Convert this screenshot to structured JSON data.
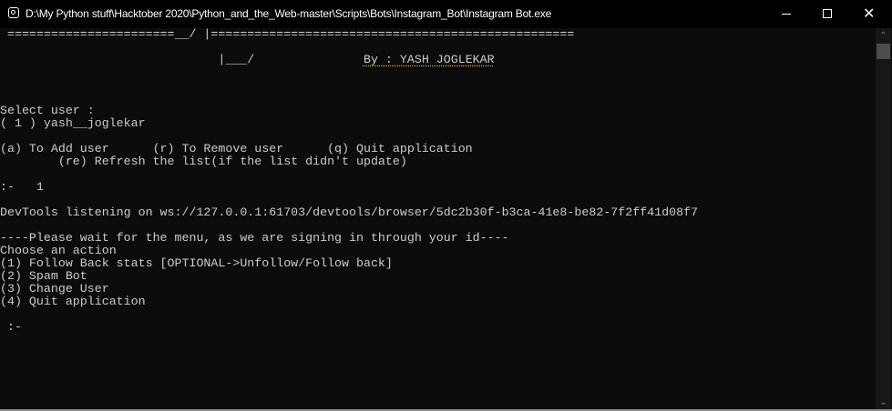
{
  "window": {
    "title": "D:\\My Python stuff\\Hacktober 2020\\Python_and_the_Web-master\\Scripts\\Bots\\Instagram_Bot\\Instagram Bot.exe",
    "minimize_icon": "minimize-icon",
    "maximize_icon": "maximize-icon",
    "close_glyph": "✕"
  },
  "console": {
    "banner_line": " =======================__/ |==================================================",
    "banner_line2": "                              |___/               ",
    "author": "By : YASH JOGLEKAR",
    "select_user": "Select user :",
    "user_1": "( 1 ) yash__joglekar",
    "options": "(a) To Add user      (r) To Remove user      (q) Quit application",
    "refresh_option": "        (re) Refresh the list(if the list didn't update)",
    "prompt_1": ":-   1",
    "devtools": "DevTools listening on ws://127.0.0.1:61703/devtools/browser/5dc2b30f-b3ca-41e8-be82-7f2ff41d08f7",
    "wait_msg": "----Please wait for the menu, as we are signing in through your id----",
    "choose_action": "Choose an action",
    "action_1": "(1) Follow Back stats [OPTIONAL->Unfollow/Follow back]",
    "action_2": "(2) Spam Bot",
    "action_3": "(3) Change User",
    "action_4": "(4) Quit application",
    "prompt_2": " :-"
  },
  "scrollbar": {
    "up": "⌃",
    "down": "⌄"
  }
}
